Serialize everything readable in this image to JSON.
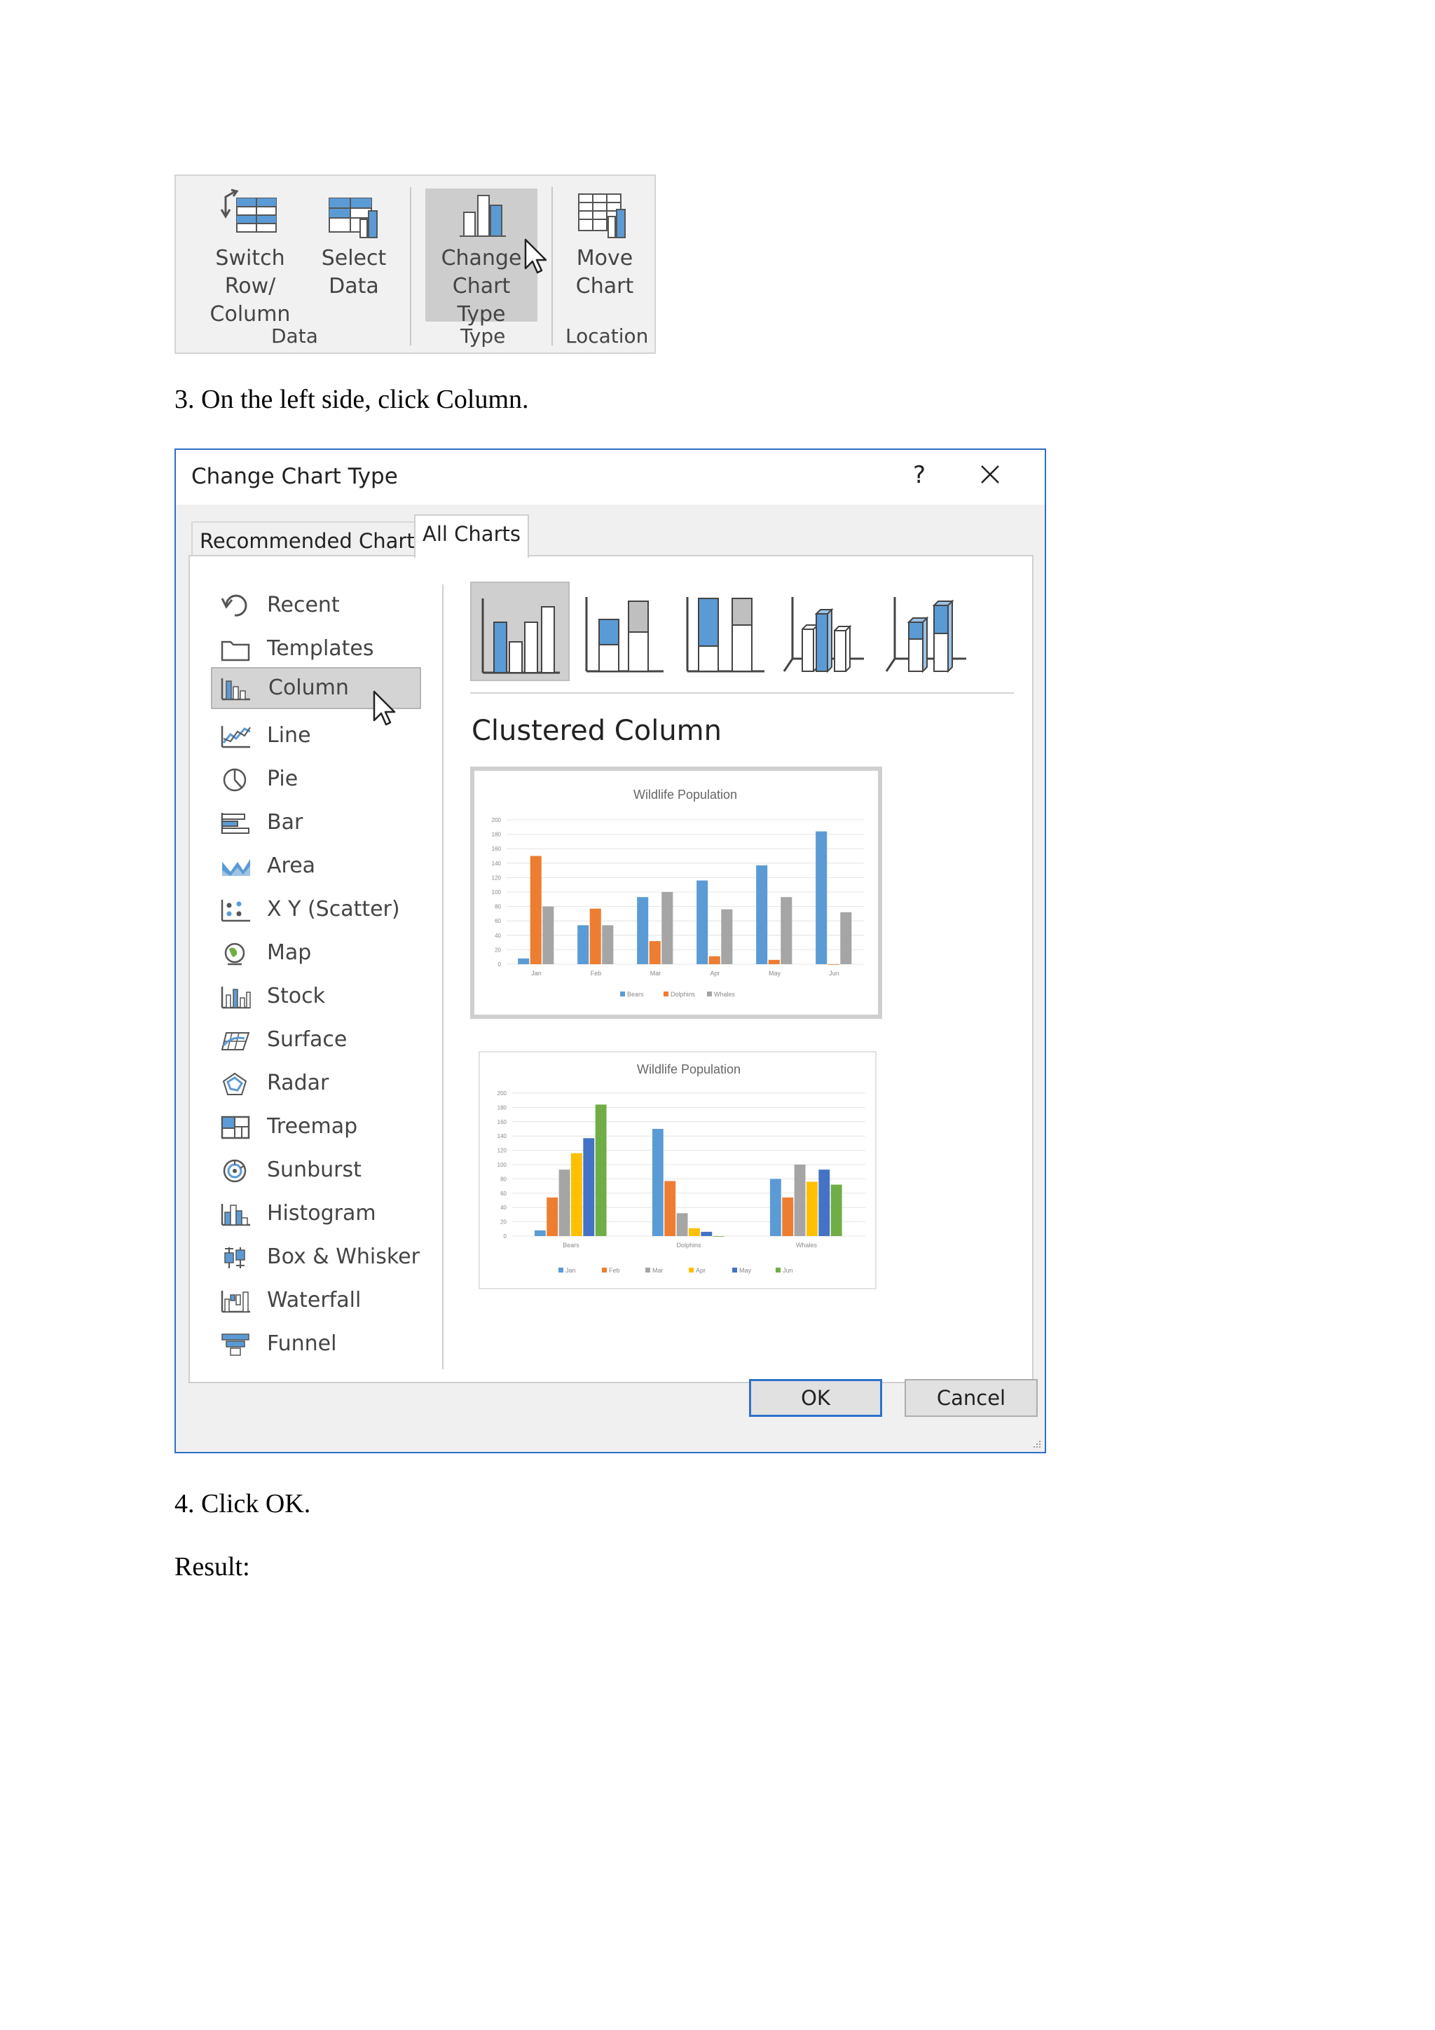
{
  "ribbon": {
    "buttons": [
      {
        "line1": "Switch Row/",
        "line2": "Column"
      },
      {
        "line1": "Select",
        "line2": "Data"
      },
      {
        "line1": "Change",
        "line2": "Chart Type"
      },
      {
        "line1": "Move",
        "line2": "Chart"
      }
    ],
    "groups": [
      "Data",
      "Type",
      "Location"
    ]
  },
  "steps": {
    "step3": "3. On the left side, click Column.",
    "step4": "4. Click OK.",
    "result": "Result:"
  },
  "dialog": {
    "title": "Change Chart Type",
    "help": "?",
    "tabs": [
      "Recommended Charts",
      "All Charts"
    ],
    "chart_types": [
      "Recent",
      "Templates",
      "Column",
      "Line",
      "Pie",
      "Bar",
      "Area",
      "X Y (Scatter)",
      "Map",
      "Stock",
      "Surface",
      "Radar",
      "Treemap",
      "Sunburst",
      "Histogram",
      "Box & Whisker",
      "Waterfall",
      "Funnel"
    ],
    "selected_type": "Column",
    "subtype_title": "Clustered Column",
    "ok": "OK",
    "cancel": "Cancel"
  },
  "colors": {
    "blue": "#5b9bd5",
    "orange": "#ed7d31",
    "gray": "#a5a5a5",
    "yellow": "#ffc000",
    "darkblue": "#4472c4",
    "green": "#70ad47",
    "accent": "#2f73c9"
  },
  "chart_data": [
    {
      "type": "bar",
      "title": "Wildlife Population",
      "categories": [
        "Jan",
        "Feb",
        "Mar",
        "Apr",
        "May",
        "Jun"
      ],
      "series": [
        {
          "name": "Bears",
          "values": [
            8,
            54,
            93,
            116,
            137,
            184
          ]
        },
        {
          "name": "Dolphins",
          "values": [
            150,
            77,
            32,
            11,
            6,
            0
          ]
        },
        {
          "name": "Whales",
          "values": [
            80,
            54,
            100,
            76,
            93,
            72
          ]
        }
      ],
      "yticks": [
        "0",
        "20",
        "40",
        "60",
        "80",
        "100",
        "120",
        "140",
        "160",
        "180",
        "200"
      ],
      "ylim": [
        0,
        200
      ]
    },
    {
      "type": "bar",
      "title": "Wildlife Population",
      "categories": [
        "Bears",
        "Dolphins",
        "Whales"
      ],
      "series": [
        {
          "name": "Jan",
          "values": [
            8,
            150,
            80
          ]
        },
        {
          "name": "Feb",
          "values": [
            54,
            77,
            54
          ]
        },
        {
          "name": "Mar",
          "values": [
            93,
            32,
            100
          ]
        },
        {
          "name": "Apr",
          "values": [
            116,
            11,
            76
          ]
        },
        {
          "name": "May",
          "values": [
            137,
            6,
            93
          ]
        },
        {
          "name": "Jun",
          "values": [
            184,
            0,
            72
          ]
        }
      ],
      "yticks": [
        "0",
        "20",
        "40",
        "60",
        "80",
        "100",
        "120",
        "140",
        "160",
        "180",
        "200"
      ],
      "ylim": [
        0,
        200
      ]
    }
  ]
}
